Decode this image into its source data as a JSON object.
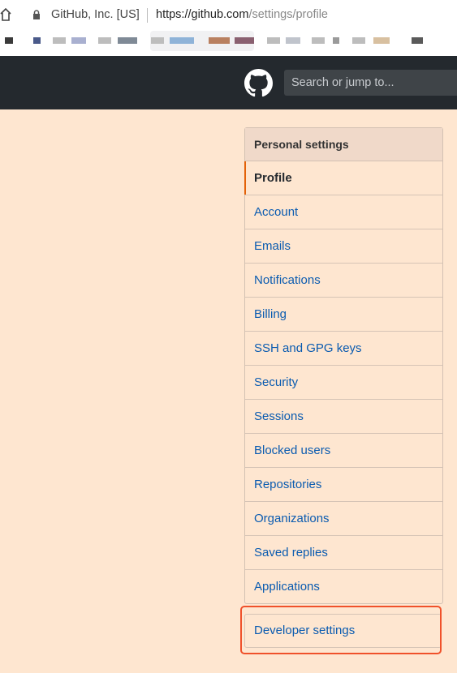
{
  "browser": {
    "site_identity": "GitHub, Inc. [US]",
    "url_host": "https://github.com",
    "url_path": "/settings/profile"
  },
  "header": {
    "search_placeholder": "Search or jump to..."
  },
  "settings_menu": {
    "heading": "Personal settings",
    "items": [
      {
        "label": "Profile"
      },
      {
        "label": "Account"
      },
      {
        "label": "Emails"
      },
      {
        "label": "Notifications"
      },
      {
        "label": "Billing"
      },
      {
        "label": "SSH and GPG keys"
      },
      {
        "label": "Security"
      },
      {
        "label": "Sessions"
      },
      {
        "label": "Blocked users"
      },
      {
        "label": "Repositories"
      },
      {
        "label": "Organizations"
      },
      {
        "label": "Saved replies"
      },
      {
        "label": "Applications"
      }
    ],
    "selected": "Profile"
  },
  "developer_settings": {
    "label": "Developer settings"
  },
  "colors": {
    "page_background": "#fee6d0",
    "header_background": "#24292e",
    "link": "#0a5bb0",
    "selected_marker": "#e36209",
    "highlight_box": "#f0512a"
  }
}
